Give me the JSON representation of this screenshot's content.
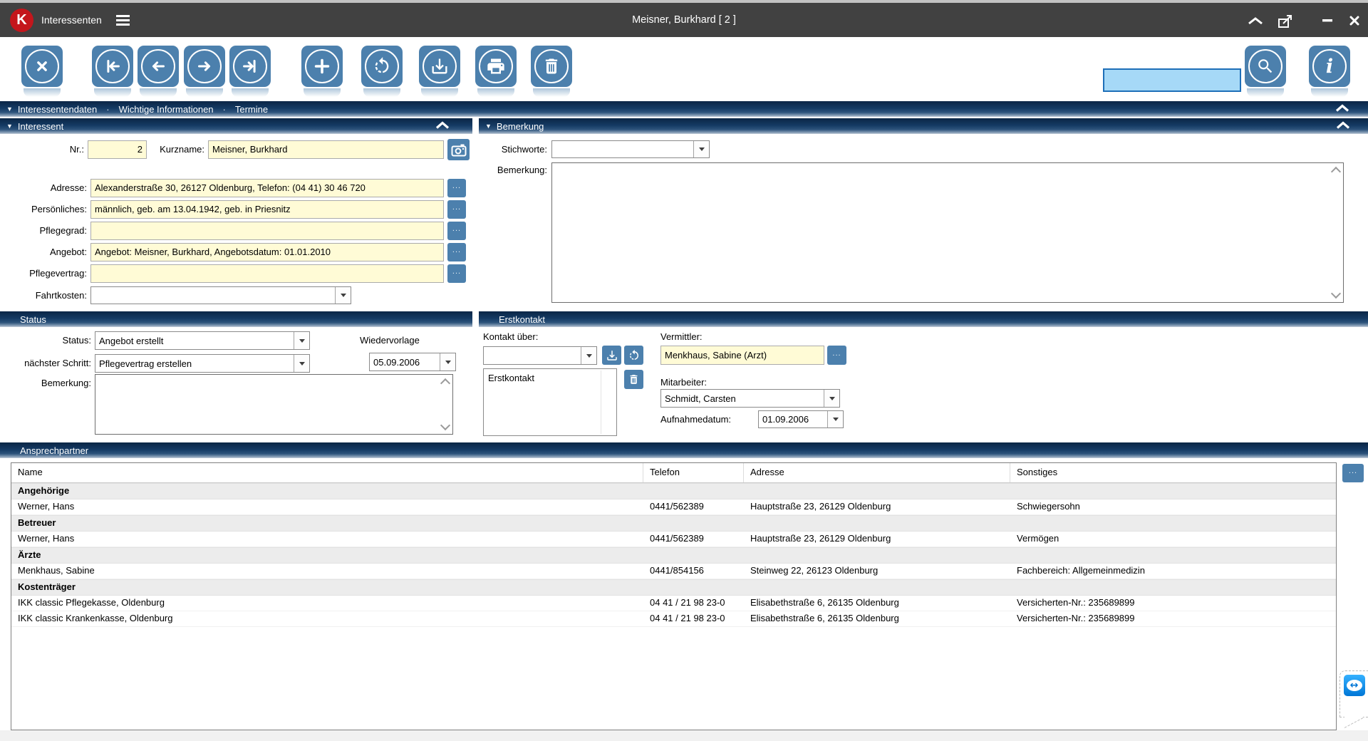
{
  "colors": {
    "accent_blue": "#4C80AD",
    "titlebar_gray": "#414141",
    "header_navy_top": "#0B2646",
    "field_yellow": "#FFFBD6",
    "search_fill": "#A6D9F7",
    "search_border": "#1E6FB8",
    "logo_red": "#C4161C",
    "group_row_gray": "#ECECEC"
  },
  "icons": {
    "logo": "K",
    "ellipsis": "...",
    "tab_separator": "·",
    "section_expand": "▼",
    "teamviewer_arrows": "↔"
  },
  "window": {
    "app_title": "Interessenten",
    "record_title": "Meisner, Burkhard  [ 2 ]"
  },
  "tabs": {
    "items": [
      "Interessentendaten",
      "Wichtige Informationen",
      "Termine"
    ]
  },
  "interessent": {
    "title": "Interessent",
    "nr_label": "Nr.:",
    "nr_value": "2",
    "kurzname_label": "Kurzname:",
    "kurzname_value": "Meisner, Burkhard",
    "rows": [
      {
        "label": "Adresse:",
        "value": "Alexanderstraße 30, 26127 Oldenburg, Telefon: (04 41) 30 46 720"
      },
      {
        "label": "Persönliches:",
        "value": "männlich, geb. am 13.04.1942, geb. in Priesnitz"
      },
      {
        "label": "Pflegegrad:",
        "value": ""
      },
      {
        "label": "Angebot:",
        "value": "Angebot: Meisner, Burkhard, Angebotsdatum: 01.01.2010"
      },
      {
        "label": "Pflegevertrag:",
        "value": ""
      }
    ],
    "fahrtkosten_label": "Fahrtkosten:",
    "fahrtkosten_value": ""
  },
  "bemerkung": {
    "title": "Bemerkung",
    "stichworte_label": "Stichworte:",
    "stichworte_value": "",
    "bemerkung_label": "Bemerkung:",
    "bemerkung_value": ""
  },
  "status": {
    "title": "Status",
    "status_label": "Status:",
    "status_value": "Angebot erstellt",
    "wiedervorlage_label": "Wiedervorlage",
    "wiedervorlage_date": "05.09.2006",
    "next_step_label": "nächster Schritt:",
    "next_step_value": "Pflegevertrag erstellen",
    "bemerkung_label": "Bemerkung:",
    "bemerkung_value": ""
  },
  "erstkontakt": {
    "title": "Erstkontakt",
    "kontakt_ueber_label": "Kontakt über:",
    "kontakt_ueber_value": "",
    "list_items": [
      "Erstkontakt"
    ],
    "vermittler_label": "Vermittler:",
    "vermittler_value": "Menkhaus, Sabine (Arzt)",
    "mitarbeiter_label": "Mitarbeiter:",
    "mitarbeiter_value": "Schmidt, Carsten",
    "aufnahmedatum_label": "Aufnahmedatum:",
    "aufnahmedatum_value": "01.09.2006"
  },
  "ansprechpartner": {
    "title": "Ansprechpartner",
    "columns": [
      "Name",
      "Telefon",
      "Adresse",
      "Sonstiges"
    ],
    "rows": [
      {
        "type": "group",
        "name": "Angehörige"
      },
      {
        "type": "data",
        "name": "Werner, Hans",
        "telefon": "0441/562389",
        "adresse": "Hauptstraße 23, 26129 Oldenburg",
        "sonstiges": "Schwiegersohn"
      },
      {
        "type": "group",
        "name": "Betreuer"
      },
      {
        "type": "data",
        "name": "Werner, Hans",
        "telefon": "0441/562389",
        "adresse": "Hauptstraße 23, 26129 Oldenburg",
        "sonstiges": "Vermögen"
      },
      {
        "type": "group",
        "name": "Ärzte"
      },
      {
        "type": "data",
        "name": "Menkhaus, Sabine",
        "telefon": "0441/854156",
        "adresse": "Steinweg 22, 26123 Oldenburg",
        "sonstiges": "Fachbereich: Allgemeinmedizin"
      },
      {
        "type": "group",
        "name": "Kostenträger"
      },
      {
        "type": "data",
        "name": "IKK classic Pflegekasse, Oldenburg",
        "telefon": "04 41 / 21 98 23-0",
        "adresse": "Elisabethstraße 6, 26135 Oldenburg",
        "sonstiges": "Versicherten-Nr.: 235689899"
      },
      {
        "type": "data",
        "name": "IKK classic Krankenkasse, Oldenburg",
        "telefon": "04 41 / 21 98 23-0",
        "adresse": "Elisabethstraße 6, 26135 Oldenburg",
        "sonstiges": "Versicherten-Nr.: 235689899"
      }
    ]
  }
}
